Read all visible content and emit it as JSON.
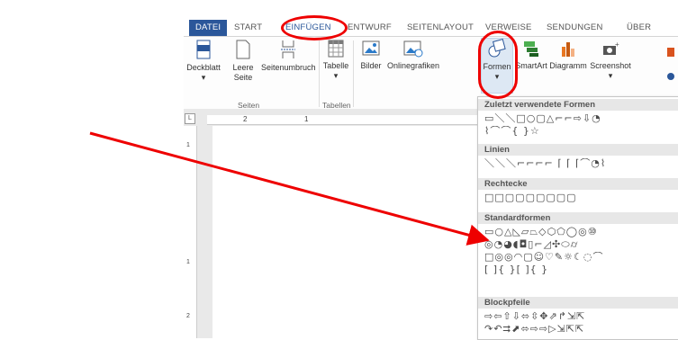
{
  "tabs": [
    "DATEI",
    "START",
    "EINFÜGEN",
    "ENTWURF",
    "SEITENLAYOUT",
    "VERWEISE",
    "SENDUNGEN",
    "ÜBER"
  ],
  "ribbon": {
    "pages_group": {
      "label": "Seiten",
      "buttons": [
        "Deckblatt",
        "Leere Seite",
        "Seitenumbruch"
      ]
    },
    "tables_group": {
      "label": "Tabellen",
      "buttons": [
        "Tabelle"
      ]
    },
    "illustrations": {
      "buttons": [
        "Bilder",
        "Onlinegrafiken",
        "Formen",
        "SmartArt",
        "Diagramm",
        "Screenshot"
      ]
    }
  },
  "ruler": {
    "corner": "L",
    "top_marks": [
      "2",
      "1"
    ],
    "left_marks": [
      "1",
      "1",
      "2"
    ]
  },
  "shapes_gallery": {
    "sections": [
      {
        "title": "Zuletzt verwendete Formen",
        "rows": [
          "▭＼＼□○▢△⌐⌐⇨⇩◔",
          "⌇⌒⌒{ }☆"
        ]
      },
      {
        "title": "Linien",
        "rows": [
          "＼＼＼⌐⌐⌐⌐ ⌈ ⌈ ⌈⌒◔⌇"
        ]
      },
      {
        "title": "Rechtecke",
        "rows": [
          "□□▢▢▢▢▢▢▢"
        ]
      },
      {
        "title": "Standardformen",
        "rows": [
          "▭○△◺▱⏢◇⬡⬠◯◎⑩",
          "◎◔◕◖◘▯⌐◿✣⬭⌭",
          "□◎◎◠▢☺♡✎☼☾◌⌒",
          "[ ]{ }[ ]{ }"
        ]
      },
      {
        "title": "Blockpfeile",
        "rows": [
          "⇨⇦⇧⇩⬄⇳✥⇗↱⇲⇱",
          "↷↶⮆⬈⬄⇨⇨▷⇲⇱⇱"
        ]
      }
    ]
  }
}
